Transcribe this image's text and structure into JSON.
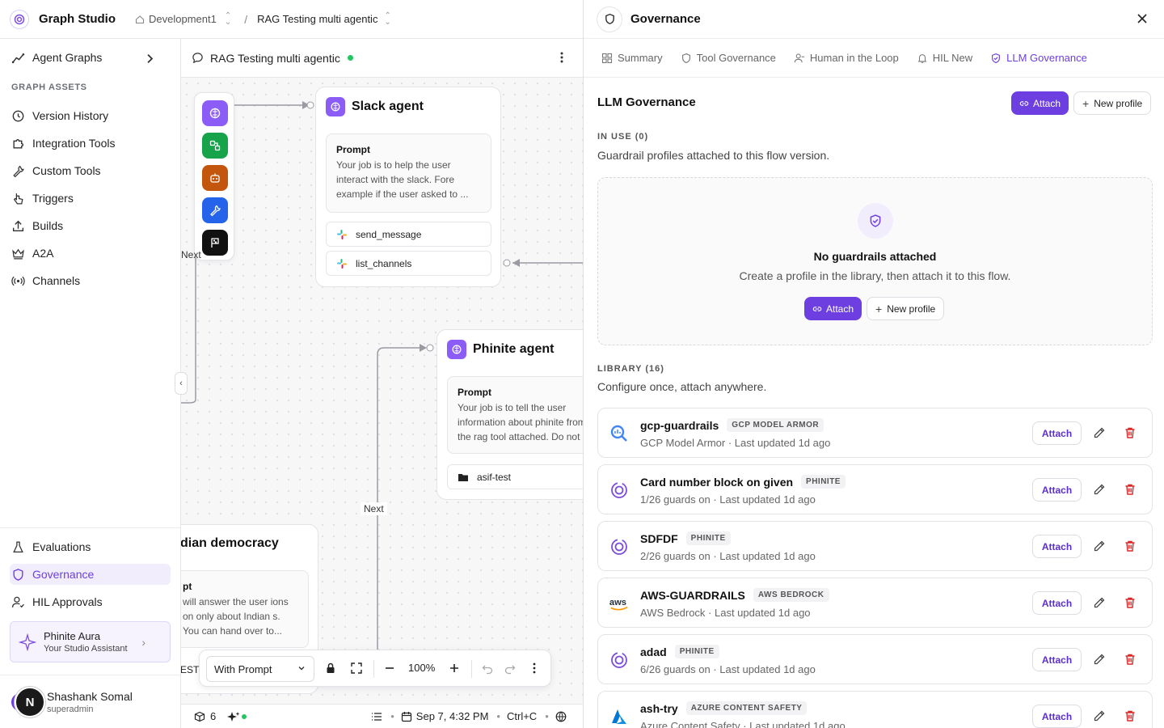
{
  "app": {
    "title": "Graph Studio"
  },
  "breadcrumb": {
    "workspace": "Development1",
    "flow": "RAG Testing multi agentic"
  },
  "sidebar": {
    "agent_graphs": "Agent Graphs",
    "section_label": "GRAPH ASSETS",
    "items": [
      {
        "label": "Version History",
        "icon": "history-icon"
      },
      {
        "label": "Integration Tools",
        "icon": "puzzle-icon"
      },
      {
        "label": "Custom Tools",
        "icon": "wrench-icon"
      },
      {
        "label": "Triggers",
        "icon": "pointer-icon"
      },
      {
        "label": "Builds",
        "icon": "upload-icon"
      },
      {
        "label": "A2A",
        "icon": "crown-icon"
      },
      {
        "label": "Channels",
        "icon": "broadcast-icon"
      }
    ],
    "bottom_items": [
      {
        "label": "Evaluations",
        "icon": "flask-icon"
      },
      {
        "label": "Governance",
        "icon": "shield-icon",
        "active": true
      },
      {
        "label": "HIL Approvals",
        "icon": "user-check-icon"
      }
    ],
    "assistant": {
      "name": "Phinite Aura",
      "subtitle": "Your Studio Assistant"
    },
    "user": {
      "name": "Shashank Somal",
      "role": "superadmin",
      "avatar_letter": "N"
    }
  },
  "canvas": {
    "title": "RAG Testing multi agentic",
    "status_color": "#22c55e",
    "nodes": {
      "slack": {
        "title": "Slack agent",
        "prompt_label": "Prompt",
        "prompt_text": "Your job is to help the user interact with the slack. Fore example if the user asked to ...",
        "tools": [
          "send_message",
          "list_channels"
        ]
      },
      "phinite": {
        "title": "Phinite agent",
        "prompt_label": "Prompt",
        "prompt_text": "Your job is to tell the user information about phinite from the rag tool attached. Do not",
        "tools": [
          "asif-test"
        ]
      },
      "indian": {
        "title": "dian democracy",
        "prompt_label": "pt",
        "prompt_text": "will answer the user ions on only about Indian s. You can hand over to...",
        "footer": "EST"
      }
    },
    "edge_labels": {
      "left": "Next",
      "middle": "Next"
    },
    "toolbar": {
      "mode": "With Prompt",
      "zoom": "100%"
    },
    "status": {
      "count": "6",
      "timestamp": "Sep 7, 4:32 PM",
      "shortcut": "Ctrl+C"
    }
  },
  "governance": {
    "title": "Governance",
    "tabs": [
      {
        "label": "Summary",
        "icon": "grid-icon"
      },
      {
        "label": "Tool Governance",
        "icon": "shield-icon"
      },
      {
        "label": "Human in the Loop",
        "icon": "user-icon"
      },
      {
        "label": "HIL New",
        "icon": "bell-icon"
      },
      {
        "label": "LLM Governance",
        "icon": "shield-check-icon",
        "active": true
      }
    ],
    "section_title": "LLM Governance",
    "attach_label": "Attach",
    "new_profile_label": "New profile",
    "in_use": {
      "label": "IN USE (0)",
      "description": "Guardrail profiles attached to this flow version."
    },
    "empty": {
      "title": "No guardrails attached",
      "description": "Create a profile in the library, then attach it to this flow."
    },
    "library": {
      "label": "LIBRARY (16)",
      "description": "Configure once, attach anywhere.",
      "items": [
        {
          "name": "gcp-guardrails",
          "badge": "GCP MODEL ARMOR",
          "subtitle": "GCP Model Armor · Last updated 1d ago",
          "icon": "gcp-icon",
          "action": "Attach"
        },
        {
          "name": "Card number block on given",
          "badge": "PHINITE",
          "subtitle": "1/26 guards on · Last updated 1d ago",
          "icon": "phinite-icon",
          "action": "Attach"
        },
        {
          "name": "SDFDF",
          "badge": "PHINITE",
          "subtitle": "2/26 guards on · Last updated 1d ago",
          "icon": "phinite-icon",
          "action": "Attach"
        },
        {
          "name": "AWS-GUARDRAILS",
          "badge": "AWS BEDROCK",
          "subtitle": "AWS Bedrock · Last updated 1d ago",
          "icon": "aws-icon",
          "action": "Attach"
        },
        {
          "name": "adad",
          "badge": "PHINITE",
          "subtitle": "6/26 guards on · Last updated 1d ago",
          "icon": "phinite-icon",
          "action": "Attach"
        },
        {
          "name": "ash-try",
          "badge": "AZURE CONTENT SAFETY",
          "subtitle": "Azure Content Safety · Last updated 1d ago",
          "icon": "azure-icon",
          "action": "Attach"
        }
      ]
    },
    "colors": {
      "accent": "#6d3fe0",
      "danger": "#dc2626"
    }
  }
}
